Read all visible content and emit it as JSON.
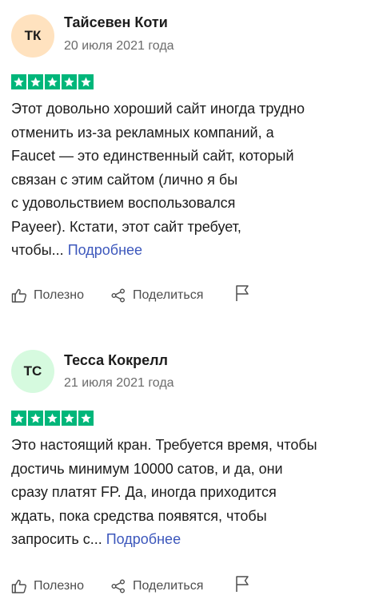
{
  "colors": {
    "star_green": "#00b67a",
    "link_blue": "#3c57bc",
    "avatar_peach": "#ffe2bf",
    "avatar_mint": "#d6fadf"
  },
  "reviews": [
    {
      "initials": "ТК",
      "name": "Тайсевен Коти",
      "date": "20 июля 2021 года",
      "rating": 5,
      "text_lines": [
        "Этот довольно хороший сайт иногда трудно",
        "отменить из-за рекламных компаний, а",
        "Faucet — это единственный сайт, который",
        "связан с этим сайтом (лично я бы",
        "с удовольствием воспользовался",
        "Payeer). Кстати, этот сайт требует,",
        "чтобы..."
      ],
      "more_label": "Подробнее",
      "useful_label": "Полезно",
      "share_label": "Поделиться"
    },
    {
      "initials": "ТС",
      "name": "Тесса Кокрелл",
      "date": "21 июля 2021 года",
      "rating": 5,
      "text_lines": [
        "Это настоящий кран. Требуется время, чтобы",
        "достичь минимум 10000 сатов, и да, они",
        "сразу платят FP. Да, иногда приходится",
        "ждать, пока средства появятся, чтобы",
        "запросить с..."
      ],
      "more_label": "Подробнее",
      "useful_label": "Полезно",
      "share_label": "Поделиться"
    }
  ]
}
